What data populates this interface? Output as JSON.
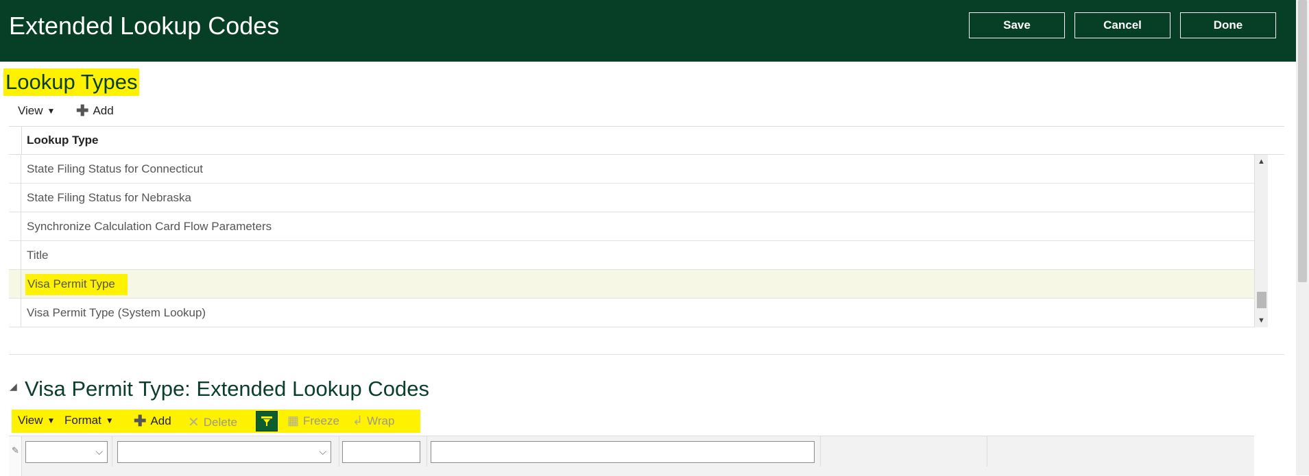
{
  "header": {
    "title": "Extended Lookup Codes",
    "buttons": {
      "save": "Save",
      "cancel": "Cancel",
      "done": "Done"
    }
  },
  "lookup_types": {
    "section_title": "Lookup Types",
    "toolbar": {
      "view": "View",
      "add": "Add"
    },
    "column_header": "Lookup Type",
    "rows": [
      {
        "label": "State Filing Status for Connecticut"
      },
      {
        "label": "State Filing Status for Nebraska"
      },
      {
        "label": "Synchronize Calculation Card Flow Parameters"
      },
      {
        "label": "Title"
      },
      {
        "label": "Visa Permit Type",
        "selected": true
      },
      {
        "label": "Visa Permit Type (System Lookup)"
      }
    ]
  },
  "codes": {
    "section_title": "Visa Permit Type: Extended Lookup Codes",
    "toolbar": {
      "view": "View",
      "format": "Format",
      "add": "Add",
      "delete": "Delete",
      "freeze": "Freeze",
      "wrap": "Wrap"
    },
    "filter_row": {
      "select_1": "",
      "select_2": "",
      "text_1": "",
      "text_2": ""
    }
  },
  "colors": {
    "header_bg": "#063f26",
    "highlight": "#fff200",
    "selected_row": "#f7f7e6"
  }
}
